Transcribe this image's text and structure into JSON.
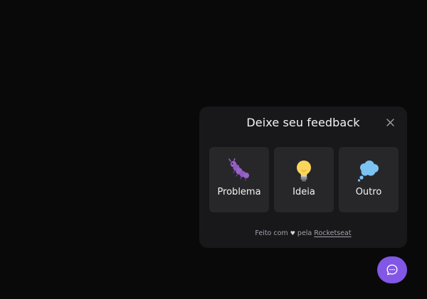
{
  "widget": {
    "title": "Deixe seu feedback",
    "close_icon": "close-icon",
    "options": [
      {
        "label": "Problema",
        "icon": "bug-icon"
      },
      {
        "label": "Ideia",
        "icon": "lightbulb-icon"
      },
      {
        "label": "Outro",
        "icon": "thought-cloud-icon"
      }
    ],
    "footer": {
      "prefix": "Feito com",
      "heart": "♥",
      "middle": "pela",
      "link_text": "Rocketseat"
    }
  },
  "fab": {
    "icon": "chat-bubble-icon"
  },
  "colors": {
    "background": "#09090a",
    "card": "#18181b",
    "option": "#27272a",
    "accent": "#8257e5",
    "text": "#f4f4f5",
    "muted": "#a1a1aa"
  }
}
